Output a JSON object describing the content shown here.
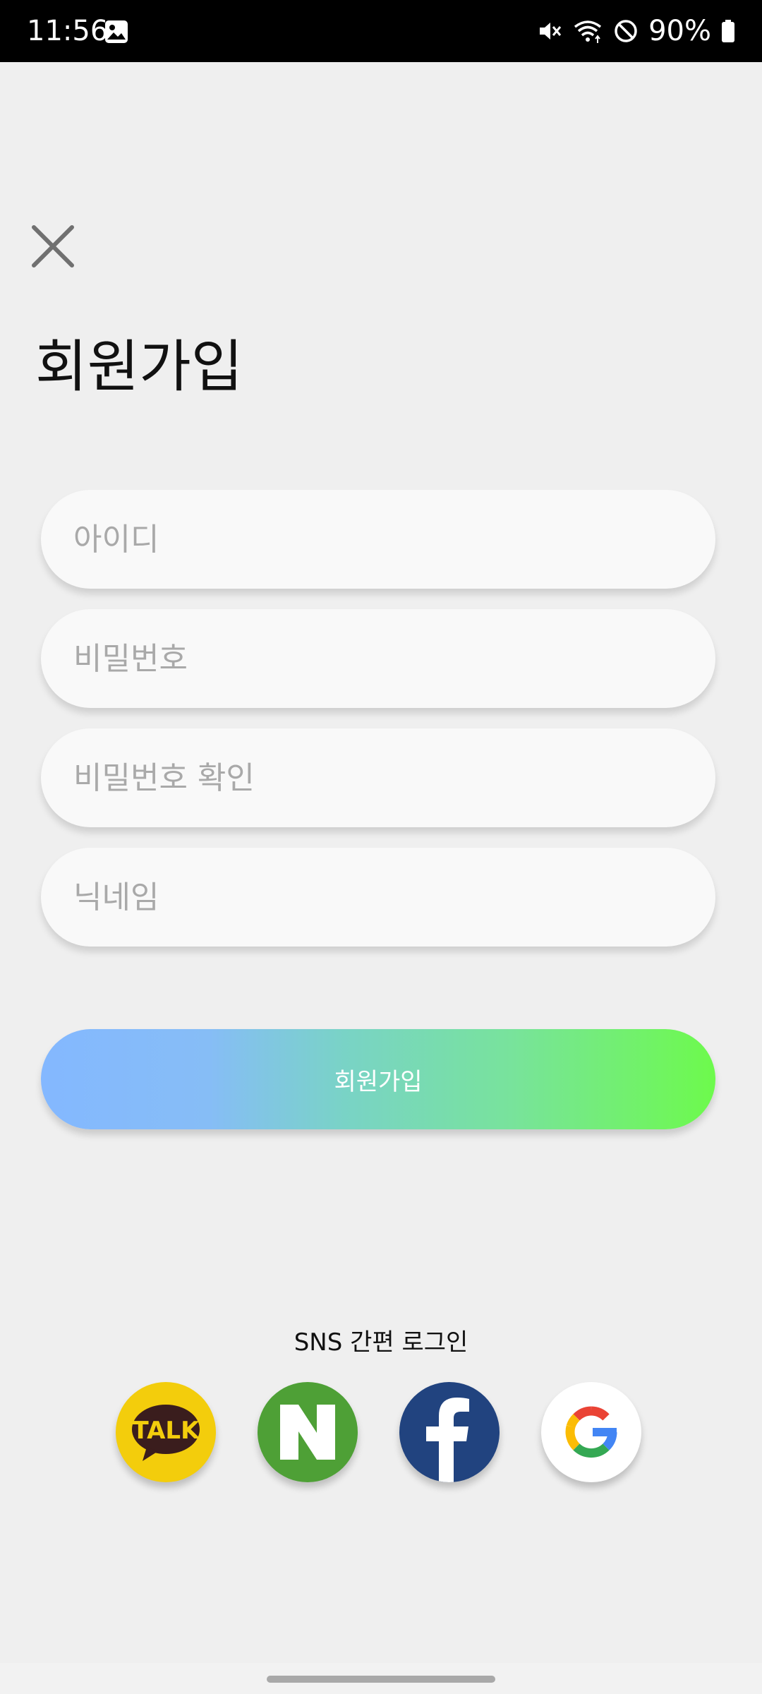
{
  "status_bar": {
    "time": "11:56",
    "battery": "90%",
    "icons": [
      "gallery-icon",
      "mute-icon",
      "wifi-icon",
      "do-not-disturb-icon",
      "battery-icon"
    ]
  },
  "header": {
    "close_icon": "close-icon",
    "title": "회원가입"
  },
  "form": {
    "id_placeholder": "아이디",
    "password_placeholder": "비밀번호",
    "password_confirm_placeholder": "비밀번호 확인",
    "nickname_placeholder": "닉네임",
    "submit_label": "회원가입"
  },
  "sns": {
    "label": "SNS 간편 로그인",
    "kakao_text": "TALK",
    "naver_text": "N",
    "buttons": [
      "kakao",
      "naver",
      "facebook",
      "google"
    ]
  },
  "colors": {
    "background": "#efefef",
    "field_background": "#f9f9f9",
    "gradient_start": "#84b8ff",
    "gradient_end": "#6dfa4c",
    "kakao": "#f3cd0c",
    "naver": "#4ea036",
    "facebook": "#21437f",
    "google": "#ffffff"
  }
}
